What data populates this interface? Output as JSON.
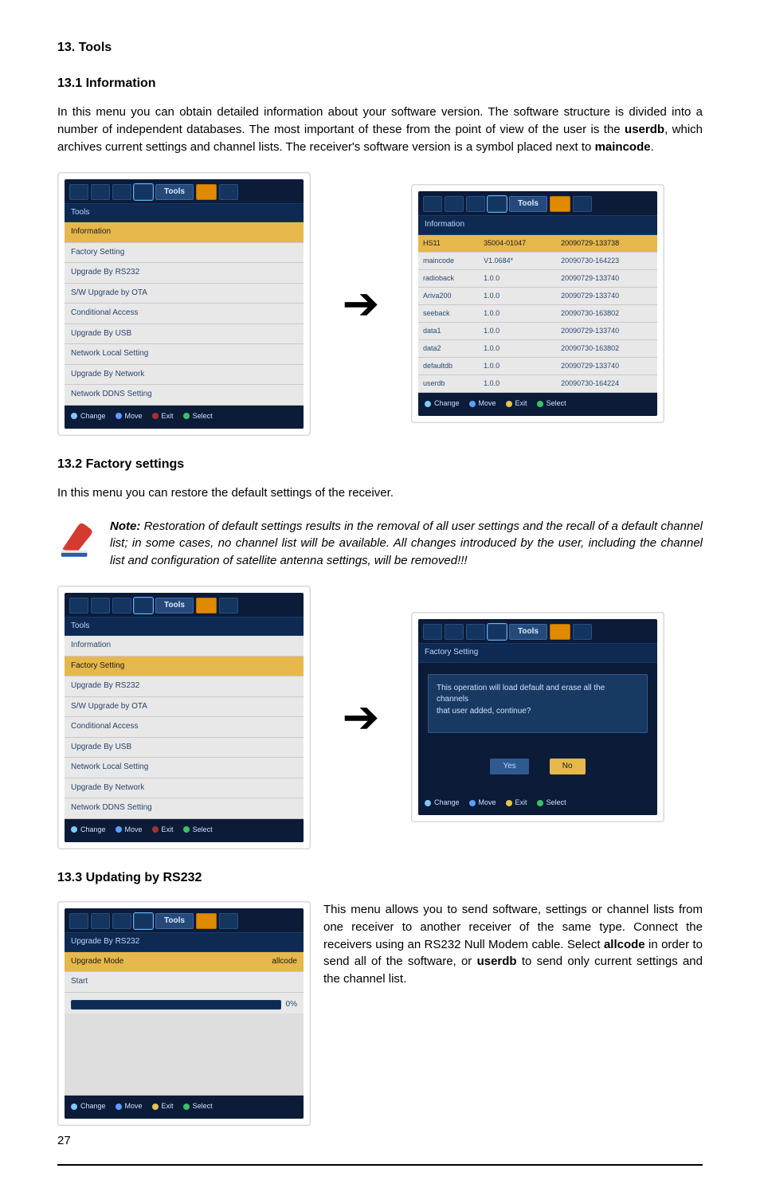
{
  "page_number": "27",
  "headings": {
    "h13": "13. Tools",
    "h131": "13.1 Information",
    "h132": "13.2 Factory settings",
    "h133": "13.3 Updating by RS232"
  },
  "para131a": "In this menu you can obtain detailed information about your software version. The software structure is divided into a number of independent databases. The most important of these from the point of view of the user is the ",
  "para131b": ", which archives current settings and channel lists. The receiver's software version is a symbol placed next to ",
  "bold_userdb": "userdb",
  "bold_maincode": "maincode",
  "period": ".",
  "para132": "In this menu you can restore the default settings of the receiver.",
  "note_label": "Note:",
  "note_text": " Restoration of default settings results in the removal of all user settings and the recall of a default channel list; in some cases, no channel list will be available. All changes introduced by the user, including the channel list and configuration of satellite antenna settings, will be removed!!!",
  "para133a": "This menu allows you to send software, settings or channel lists from one receiver to another receiver of the same type. Connect the receivers using an RS232 Null Modem cable. Select ",
  "para133b": " in order to send all of the software, or ",
  "para133c": " to send only current settings and the channel list.",
  "bold_allcode": "allcode",
  "ui": {
    "tools_tab": "Tools",
    "footer": {
      "change": "Change",
      "move": "Move",
      "exit": "Exit",
      "select": "Select"
    },
    "tools_menu": {
      "title": "Tools",
      "items": [
        "Information",
        "Factory Setting",
        "Upgrade By RS232",
        "S/W Upgrade by OTA",
        "Conditional Access",
        "Upgrade By USB",
        "Network Local Setting",
        "Upgrade By Network",
        "Network DDNS Setting"
      ]
    },
    "info": {
      "title": "Information",
      "rows": [
        {
          "a": "HS11",
          "b": "35004-01047",
          "c": "20090729-133738"
        },
        {
          "a": "maincode",
          "b": "V1.0684*",
          "c": "20090730-164223"
        },
        {
          "a": "radioback",
          "b": "1.0.0",
          "c": "20090729-133740"
        },
        {
          "a": "Ariva200",
          "b": "1.0.0",
          "c": "20090729-133740"
        },
        {
          "a": "seeback",
          "b": "1.0.0",
          "c": "20090730-163802"
        },
        {
          "a": "data1",
          "b": "1.0.0",
          "c": "20090729-133740"
        },
        {
          "a": "data2",
          "b": "1.0.0",
          "c": "20090730-163802"
        },
        {
          "a": "defaultdb",
          "b": "1.0.0",
          "c": "20090729-133740"
        },
        {
          "a": "userdb",
          "b": "1.0.0",
          "c": "20090730-164224"
        }
      ]
    },
    "factory": {
      "title": "Factory Setting",
      "msg1": "This operation will load default and erase all the channels",
      "msg2": "that user added, continue?",
      "yes": "Yes",
      "no": "No"
    },
    "rs232": {
      "title": "Upgrade By RS232",
      "mode_label": "Upgrade Mode",
      "mode_value": "allcode",
      "start": "Start",
      "pct": "0%"
    }
  }
}
